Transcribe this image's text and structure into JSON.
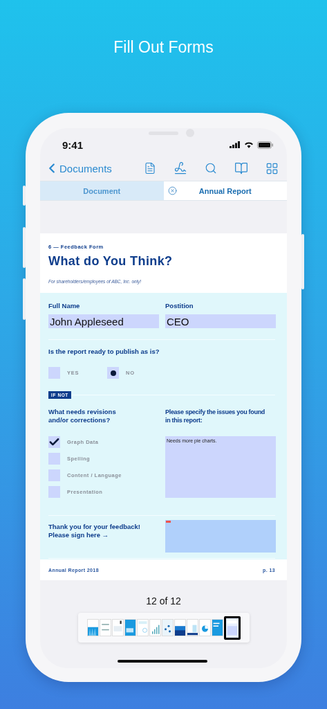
{
  "promo_title": "Fill Out Forms",
  "status_bar": {
    "time": "9:41"
  },
  "nav": {
    "back_label": "Documents"
  },
  "tabs": [
    {
      "label": "Document",
      "selected": false,
      "closable": false
    },
    {
      "label": "Annual Report",
      "selected": true,
      "closable": true
    }
  ],
  "form": {
    "section": "6 — Feedback Form",
    "title": "What do You Think?",
    "subtitle": "For shareholders/employees of ABC, Inc. only!",
    "fields": [
      {
        "label": "Full Name",
        "value": "John Appleseed"
      },
      {
        "label": "Postition",
        "value": "CEO"
      }
    ],
    "question": "Is the report ready to publish as is?",
    "options": [
      {
        "label": "YES",
        "selected": false
      },
      {
        "label": "NO",
        "selected": true
      }
    ],
    "badge": "IF NOT",
    "revisions_heading": "What needs revisions\nand/or corrections?",
    "revisions": [
      {
        "label": "Graph Data",
        "checked": true
      },
      {
        "label": "Spelling",
        "checked": false
      },
      {
        "label": "Content / Language",
        "checked": false
      },
      {
        "label": "Presentation",
        "checked": false
      }
    ],
    "issues_heading": "Please specify the issues you found\nin this report:",
    "issues_value": "Needs more pie charts.",
    "sign_prompt": "Thank you for your feedback!\nPlease sign here →"
  },
  "footer": {
    "left": "Annual Report 2018",
    "right": "p. 13"
  },
  "pager": {
    "label": "12 of 12"
  },
  "thumbnails": [
    {
      "selected": false
    },
    {
      "selected": false
    },
    {
      "selected": false
    },
    {
      "selected": false
    },
    {
      "selected": false
    },
    {
      "selected": false
    },
    {
      "selected": false
    },
    {
      "selected": false
    },
    {
      "selected": false
    },
    {
      "selected": false
    },
    {
      "selected": false
    },
    {
      "selected": true
    }
  ]
}
